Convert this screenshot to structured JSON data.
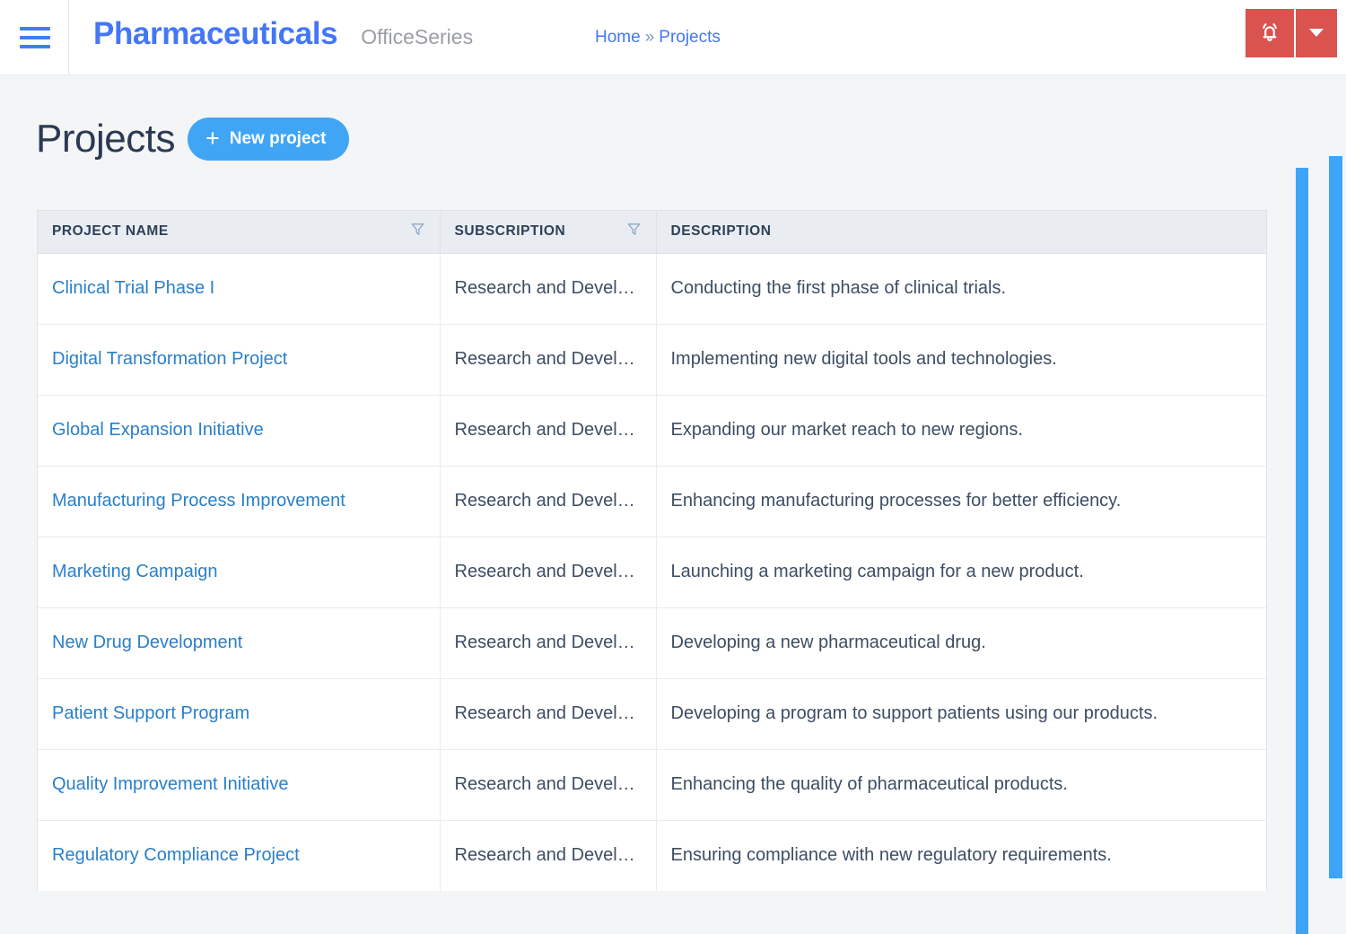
{
  "topbar": {
    "menu_icon": "hamburger-icon",
    "brand": "Pharmaceuticals",
    "subtitle": "OfficeSeries",
    "breadcrumb": {
      "home": "Home",
      "separator": "»",
      "current": "Projects"
    },
    "actions": {
      "notification_icon": "bell-icon",
      "dropdown_icon": "chevron-down-icon",
      "button_color": "#d9534f"
    }
  },
  "page": {
    "title": "Projects",
    "new_project_label": "New project",
    "new_project_icon": "plus-icon",
    "accent_color": "#41a5f5",
    "link_color": "#2a7fc9"
  },
  "table": {
    "columns": [
      {
        "label": "PROJECT NAME",
        "filterable": true,
        "filter_icon": "funnel-icon"
      },
      {
        "label": "SUBSCRIPTION",
        "filterable": true,
        "filter_icon": "funnel-icon"
      },
      {
        "label": "DESCRIPTION",
        "filterable": false,
        "filter_icon": ""
      }
    ],
    "rows": [
      {
        "name": "Clinical Trial Phase I",
        "subscription": "Research and Develop…",
        "description": "Conducting the first phase of clinical trials."
      },
      {
        "name": "Digital Transformation Project",
        "subscription": "Research and Develop…",
        "description": "Implementing new digital tools and technologies."
      },
      {
        "name": "Global Expansion Initiative",
        "subscription": "Research and Develop…",
        "description": "Expanding our market reach to new regions."
      },
      {
        "name": "Manufacturing Process Improvement",
        "subscription": "Research and Develop…",
        "description": "Enhancing manufacturing processes for better efficiency."
      },
      {
        "name": "Marketing Campaign",
        "subscription": "Research and Develop…",
        "description": "Launching a marketing campaign for a new product."
      },
      {
        "name": "New Drug Development",
        "subscription": "Research and Develop…",
        "description": "Developing a new pharmaceutical drug."
      },
      {
        "name": "Patient Support Program",
        "subscription": "Research and Develop…",
        "description": "Developing a program to support patients using our products."
      },
      {
        "name": "Quality Improvement Initiative",
        "subscription": "Research and Develop…",
        "description": "Enhancing the quality of pharmaceutical products."
      },
      {
        "name": "Regulatory Compliance Project",
        "subscription": "Research and Develop…",
        "description": "Ensuring compliance with new regulatory requirements."
      }
    ]
  },
  "scrollbars": {
    "thumb_color": "#3fa4f8"
  }
}
